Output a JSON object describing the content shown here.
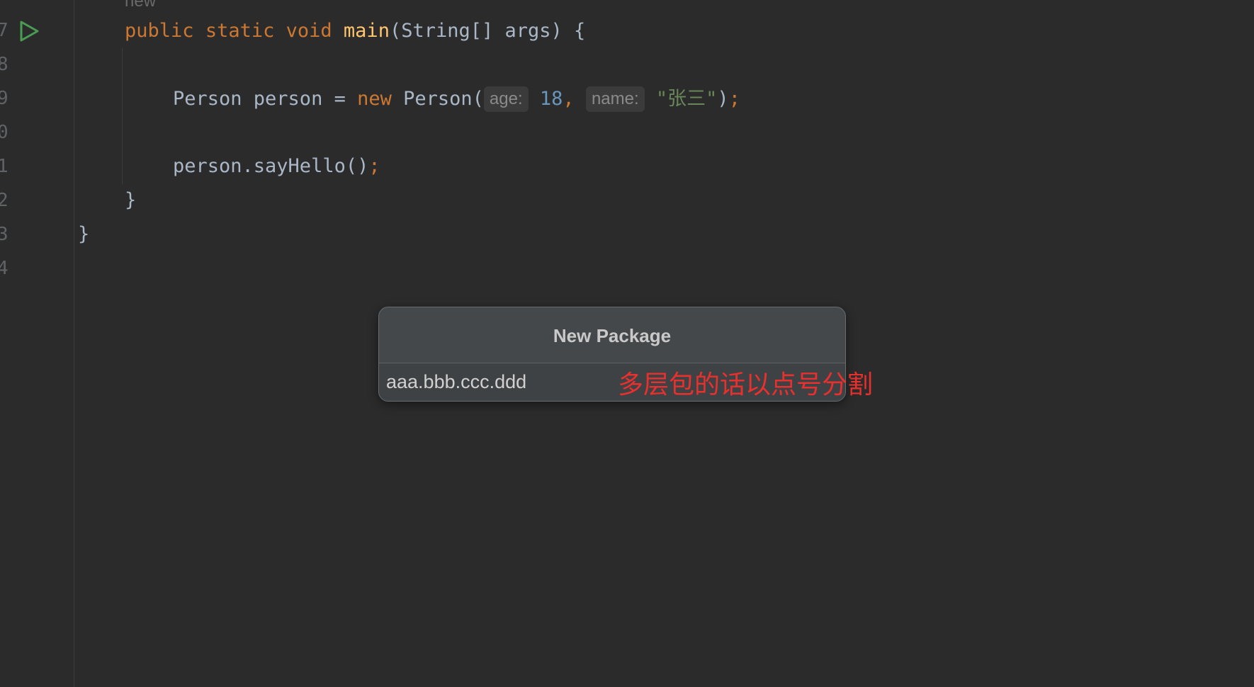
{
  "editor": {
    "faded_hint": "new",
    "line_numbers": [
      "7",
      "8",
      "9",
      "0",
      "1",
      "2",
      "3",
      "4"
    ],
    "line7": {
      "kw_public": "public",
      "kw_static": "static",
      "kw_void": "void",
      "method_name": "main",
      "rest": "(String[] args) {"
    },
    "line9": {
      "decl": "Person person = ",
      "kw_new": "new",
      "ctor": " Person(",
      "hint_age": "age:",
      "age_value": "18",
      "comma": ", ",
      "hint_name": "name:",
      "name_value": "\"张三\"",
      "close_paren": ")",
      "semicolon": ";"
    },
    "line11": {
      "call": "person.sayHello()",
      "semicolon": ";"
    },
    "line12": "}",
    "line13": "}"
  },
  "dialog": {
    "title": "New Package",
    "input_value": "aaa.bbb.ccc.ddd"
  },
  "annotation": "多层包的话以点号分割",
  "colors": {
    "background": "#2b2b2b",
    "keyword": "#cc7832",
    "function": "#ffc66d",
    "number": "#6897bb",
    "string": "#6a8759",
    "annotation": "#e8302e",
    "run_icon": "#499c54"
  },
  "icons": {
    "run": "run-gutter-icon"
  }
}
